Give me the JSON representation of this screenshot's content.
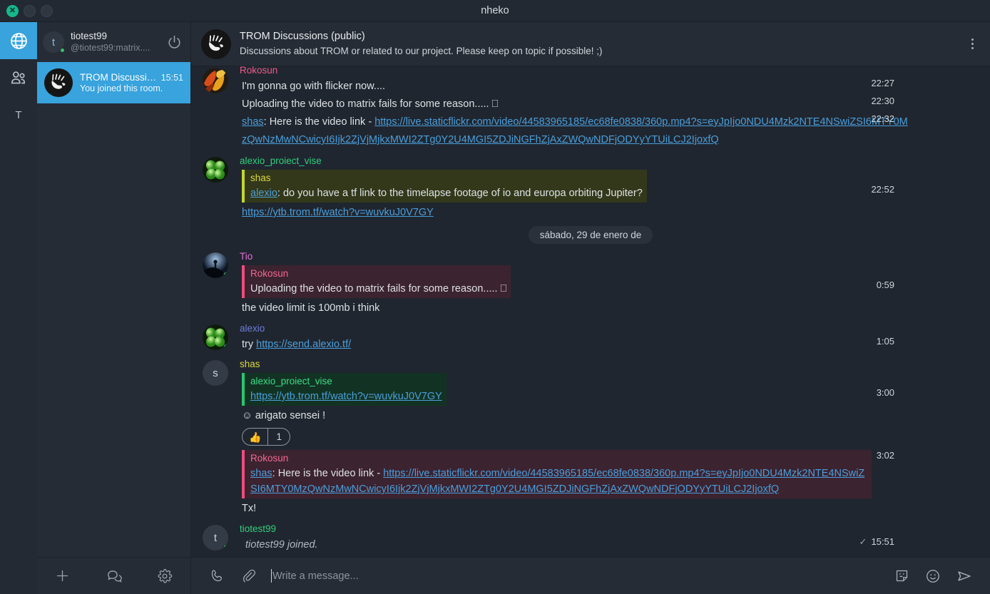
{
  "window": {
    "title": "nheko",
    "controls": {
      "close": "×",
      "minimize": "",
      "maximize": ""
    }
  },
  "rail": {
    "items": [
      {
        "name": "globe-icon",
        "label": "",
        "active": true
      },
      {
        "name": "people-icon",
        "label": "",
        "active": false
      },
      {
        "name": "space-avatar-t",
        "label": "T",
        "active": false
      }
    ]
  },
  "user": {
    "avatar_letter": "t",
    "display_name": "tiotest99",
    "user_id": "@tiotest99:matrix....",
    "logout_icon": "power-icon"
  },
  "room_list": {
    "rooms": [
      {
        "name": "TROM Discussion...",
        "time": "15:51",
        "preview": "You joined this room.",
        "selected": true
      }
    ]
  },
  "room_footer": {
    "buttons": [
      {
        "name": "add-room-button",
        "icon": "plus-icon"
      },
      {
        "name": "start-chat-button",
        "icon": "chat-bubbles-icon"
      },
      {
        "name": "settings-button",
        "icon": "gear-icon"
      }
    ]
  },
  "chat_header": {
    "room_name": "TROM Discussions (public)",
    "topic": "Discussions about TROM or related to our project. Please keep on topic if possible! ;)",
    "menu_icon": "kebab-menu-icon"
  },
  "timeline": {
    "groups": [
      {
        "sender": "Rokosun",
        "sender_color": "#ef5b8c",
        "avatar_kind": "image-leaves",
        "avatar_letter": "",
        "presence": false,
        "events": [
          {
            "type": "text",
            "text": "I'm gonna go with flicker now....",
            "time": "22:27"
          },
          {
            "type": "text",
            "text": "Uploading the video to matrix fails for some reason..... ⎕",
            "time": "22:30"
          },
          {
            "type": "rich",
            "time": "22:32",
            "prefix_link": "shas",
            "prefix_text": ": Here is the video link - ",
            "link": "https://live.staticflickr.com/video/44583965185/ec68fe0838/360p.mp4?s=eyJpIjo0NDU4Mzk2NTE4NSwiZSI6MTY0MzQwNzMwNCwicyI6Ijk2ZjVjMjkxMWI2ZTg0Y2U4MGI5ZDJiNGFhZjAxZWQwNDFjODYyYTUiLCJ2IjoxfQ"
          }
        ]
      },
      {
        "sender": "alexio_proiect_vise",
        "sender_color": "#2fcf7a",
        "avatar_kind": "image-clover",
        "avatar_letter": "",
        "presence": false,
        "events": [
          {
            "type": "quote",
            "time": "22:52",
            "quote_style": "q-olive",
            "quote_sender": "shas",
            "quote_link_name": "alexio",
            "quote_text": ": do you have a tf link to the timelapse footage of io and europa orbiting Jupiter?",
            "body_link": "https://ytb.trom.tf/watch?v=wuvkuJ0V7GY"
          }
        ]
      }
    ],
    "date_separator": "sábado, 29 de enero de",
    "groups2": [
      {
        "sender": "Tio",
        "sender_color": "#e26fd4",
        "avatar_kind": "image-night",
        "avatar_letter": "",
        "presence": true,
        "events": [
          {
            "type": "quote",
            "time": "0:59",
            "quote_style": "q-pink",
            "quote_sender": "Rokosun",
            "quote_link_name": "",
            "quote_text": "Uploading the video to matrix fails for some reason..... ⎕",
            "body_text": "the video limit is 100mb i think"
          }
        ]
      },
      {
        "sender": "alexio",
        "sender_color": "#6c7bd8",
        "avatar_kind": "image-clover",
        "avatar_letter": "",
        "presence": true,
        "events": [
          {
            "type": "try-link",
            "time": "1:05",
            "pre": "try ",
            "link": "https://send.alexio.tf/"
          }
        ]
      },
      {
        "sender": "shas",
        "sender_color": "#d9d93f",
        "avatar_kind": "letter",
        "avatar_letter": "s",
        "presence": false,
        "events": [
          {
            "type": "quote",
            "time": "3:00",
            "quote_style": "q-green",
            "quote_sender": "alexio_proiect_vise",
            "quote_link": "https://ytb.trom.tf/watch?v=wuvkuJ0V7GY",
            "body_text": "☺ arigato sensei !",
            "reaction": {
              "emoji": "👍",
              "count": "1"
            }
          },
          {
            "type": "quote",
            "time": "3:02",
            "quote_style": "q-pink",
            "quote_sender": "Rokosun",
            "quote_link_name": "shas",
            "quote_text": ": Here is the video link - ",
            "quote_url": "https://live.staticflickr.com/video/44583965185/ec68fe0838/360p.mp4?s=eyJpIjo0NDU4Mzk2NTE4NSwiZSI6MTY0MzQwNzMwNCwicyI6Ijk2ZjVjMjkxMWI2ZTg0Y2U4MGI5ZDJiNGFhZjAxZWQwNDFjODYyYTUiLCJ2IjoxfQ",
            "body_text": "Tx!"
          }
        ]
      },
      {
        "sender": "tiotest99",
        "sender_color": "#2fcf7a",
        "avatar_kind": "letter",
        "avatar_letter": "t",
        "presence": true,
        "events": [
          {
            "type": "state",
            "text": "tiotest99 joined.",
            "time": "15:51",
            "check": "✓"
          }
        ]
      }
    ]
  },
  "composer": {
    "call_icon": "phone-icon",
    "attach_icon": "paperclip-icon",
    "placeholder": "Write a message...",
    "sticker_icon": "sticker-icon",
    "emoji_icon": "emoji-icon",
    "send_icon": "send-icon"
  },
  "colors": {
    "accent": "#38a3dd",
    "background": "#20262f",
    "panel": "#262c36",
    "link": "#4a9edb",
    "presence_online": "#35c46b"
  }
}
